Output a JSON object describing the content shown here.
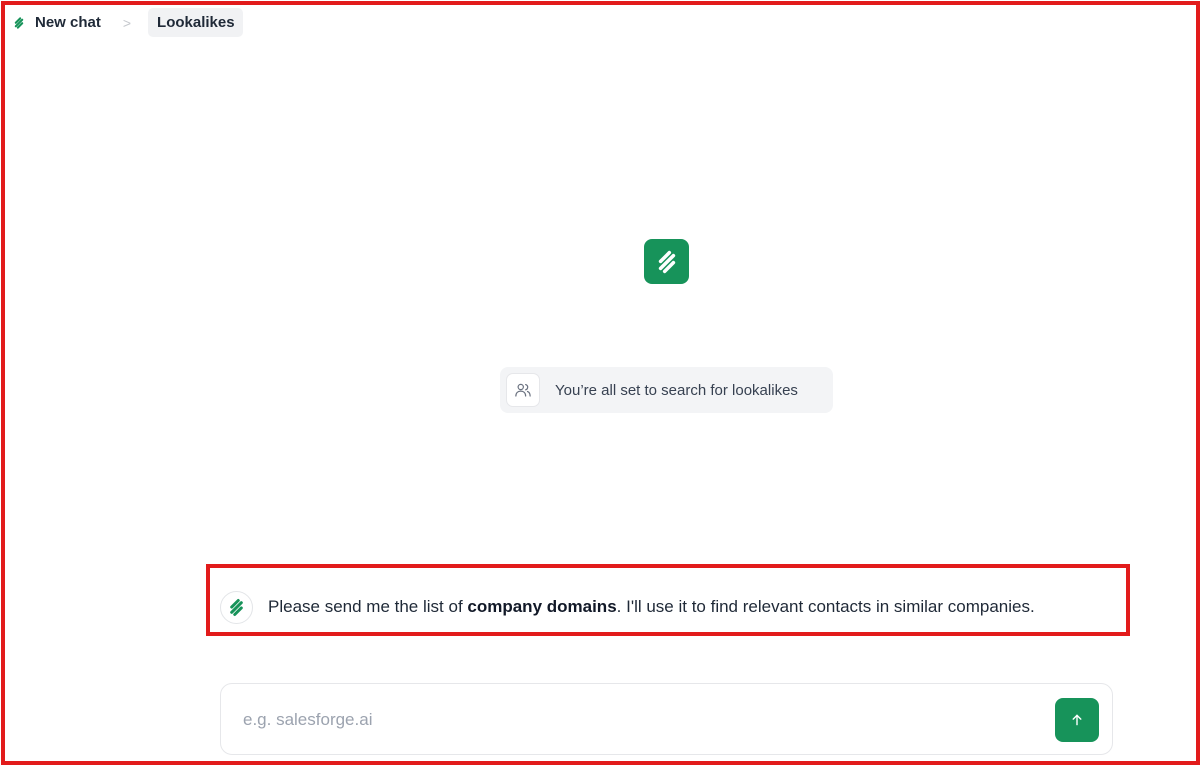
{
  "breadcrumb": {
    "items": [
      {
        "label": "New chat"
      },
      {
        "label": "Lookalikes"
      }
    ],
    "separator": ">"
  },
  "status": {
    "text": "You’re all set to search for lookalikes",
    "icon": "users-icon"
  },
  "message": {
    "prefix": "Please send me the list of ",
    "bold": "company domains",
    "suffix": ". I'll use it to find relevant contacts in similar companies.",
    "avatar_icon": "salesforge-logo-icon"
  },
  "input": {
    "placeholder": "e.g. salesforge.ai",
    "value": ""
  },
  "send_button": {
    "icon": "arrow-up-icon"
  },
  "colors": {
    "accent": "#17935a",
    "highlight_border": "#e21b1b",
    "pill_bg": "#f3f4f6"
  }
}
